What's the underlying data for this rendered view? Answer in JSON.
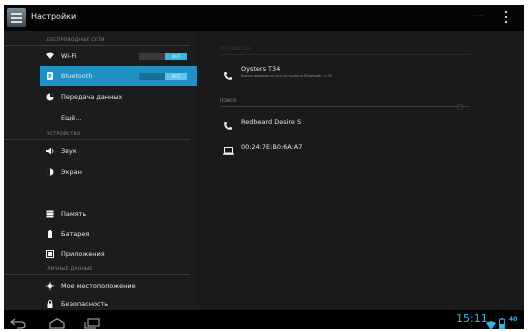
{
  "app": {
    "title": "Настройки",
    "overflow_right_label": "·····"
  },
  "left_pane": {
    "sections": [
      {
        "header": "БЕСПРОВОДНЫЕ СЕТИ"
      },
      {
        "header": "УСТРОЙСТВО"
      },
      {
        "header": "ЛИЧНЫЕ ДАННЫЕ"
      }
    ],
    "items": [
      {
        "label": "Wi-Fi",
        "icon": "wifi-icon",
        "toggle": "ВКЛ"
      },
      {
        "label": "Bluetooth",
        "icon": "bluetooth-icon",
        "toggle": "ВКЛ",
        "selected": true
      },
      {
        "label": "Передача данных",
        "icon": "data-usage-icon"
      },
      {
        "label": "Ещё...",
        "icon": ""
      },
      {
        "label": "Звук",
        "icon": "sound-icon"
      },
      {
        "label": "Экран",
        "icon": "display-icon"
      },
      {
        "label": "Память",
        "icon": "storage-icon"
      },
      {
        "label": "Батарея",
        "icon": "battery-icon"
      },
      {
        "label": "Приложения",
        "icon": "apps-icon"
      },
      {
        "label": "Мое местоположение",
        "icon": "location-icon"
      },
      {
        "label": "Безопасность",
        "icon": "lock-icon"
      }
    ]
  },
  "right_pane": {
    "header_top": "УСТРОЙСТВА",
    "own_device": {
      "name": "Oysters T34",
      "sub": "Время видимости для устройств Bluetooth: 1:59"
    },
    "list_header": "ПОИСК",
    "devices": [
      {
        "name": "Redbeard Desire S",
        "icon": "phone-icon"
      },
      {
        "name": "00:24:7E:B0:6A:A7",
        "icon": "laptop-icon"
      }
    ]
  },
  "status": {
    "time": "15:11",
    "battery_label": "40"
  },
  "colors": {
    "accent": "#33b5e5",
    "selected_row": "#1f8fc4",
    "background": "#1a1a1b"
  }
}
